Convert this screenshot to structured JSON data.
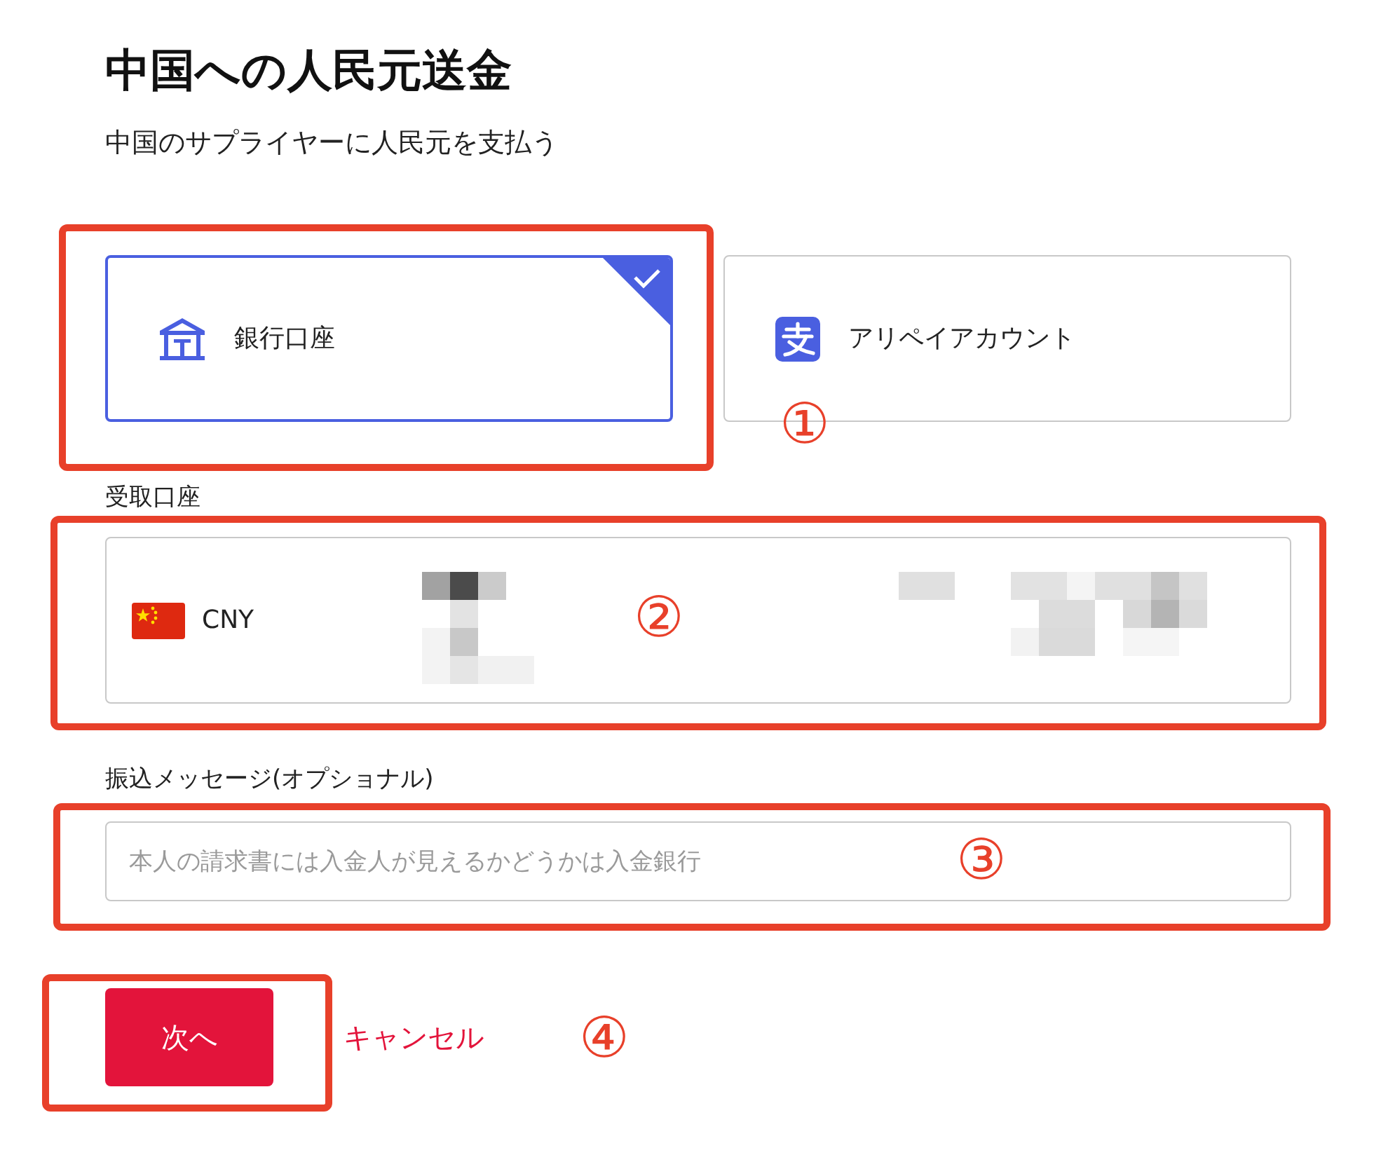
{
  "header": {
    "title": "中国への人民元送金",
    "subtitle": "中国のサプライヤーに人民元を支払う"
  },
  "payment_methods": [
    {
      "label": "銀行口座",
      "kind": "bank",
      "selected": true
    },
    {
      "label": "アリペイアカウント",
      "kind": "alipay",
      "selected": false
    }
  ],
  "receiving_account": {
    "label": "受取口座",
    "currency": "CNY"
  },
  "message": {
    "label": "振込メッセージ(オプショナル)",
    "placeholder": "本人の請求書には入金人が見えるかどうかは入金銀行"
  },
  "buttons": {
    "next": "次へ",
    "cancel": "キャンセル"
  },
  "annotations": [
    {
      "number": "①"
    },
    {
      "number": "②"
    },
    {
      "number": "③"
    },
    {
      "number": "④"
    }
  ]
}
